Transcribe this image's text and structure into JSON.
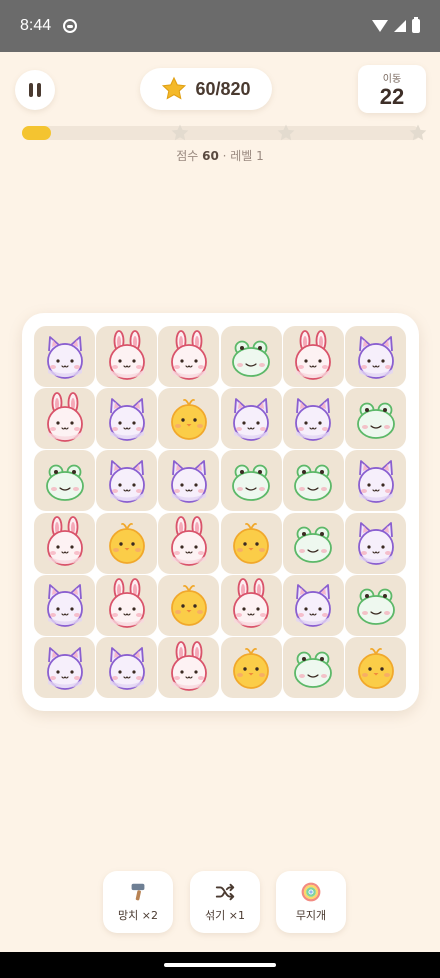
{
  "status_bar": {
    "time": "8:44"
  },
  "header": {
    "score_text": "60/820",
    "moves_label": "이동",
    "moves_value": "22"
  },
  "progress": {
    "fraction": 0.073,
    "caption_prefix": "점수",
    "score": "60",
    "caption_suffix": "· 레벨 1"
  },
  "board": {
    "rows": [
      [
        "cat",
        "bunny",
        "bunny",
        "frog",
        "bunny",
        "cat"
      ],
      [
        "bunny",
        "cat",
        "chick",
        "cat",
        "cat",
        "frog"
      ],
      [
        "frog",
        "cat",
        "cat",
        "frog",
        "frog",
        "cat"
      ],
      [
        "bunny",
        "chick",
        "bunny",
        "chick",
        "frog",
        "cat"
      ],
      [
        "cat",
        "bunny",
        "chick",
        "bunny",
        "cat",
        "frog"
      ],
      [
        "cat",
        "cat",
        "bunny",
        "chick",
        "frog",
        "chick"
      ]
    ]
  },
  "colors": {
    "cat": "#8a5fd0",
    "bunny": "#d9536a",
    "frog": "#5cb868",
    "chick": "#f1a82b",
    "tile": "#efe4d4",
    "background": "#fdf3e7",
    "accent": "#f4c430"
  },
  "tools": [
    {
      "icon": "hammer-icon",
      "label": "망치 ×2"
    },
    {
      "icon": "shuffle-icon",
      "label": "섞기 ×1"
    },
    {
      "icon": "rainbow-icon",
      "label": "무지개"
    }
  ]
}
